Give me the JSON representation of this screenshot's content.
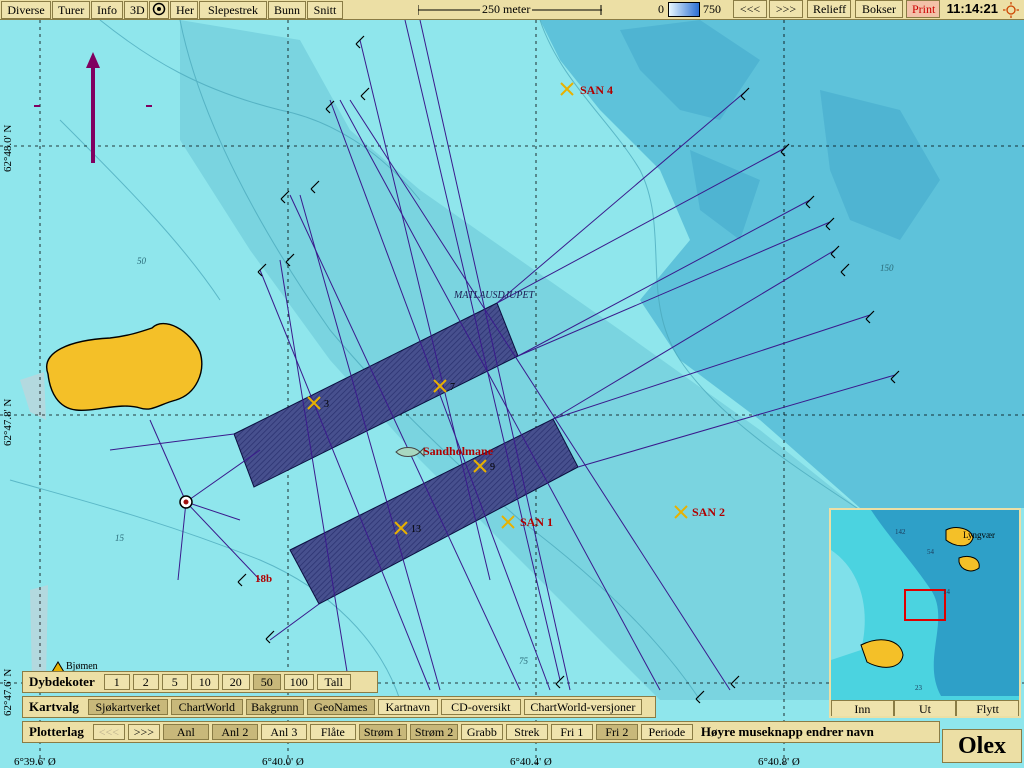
{
  "toolbar": {
    "diverse": "Diverse",
    "turer": "Turer",
    "info": "Info",
    "threed": "3D",
    "her": "Her",
    "slepestrek": "Slepestrek",
    "bunn": "Bunn",
    "snitt": "Snitt",
    "scale_label": "250 meter",
    "depth_min": "0",
    "depth_max": "750",
    "back": "<<<",
    "fwd": ">>>",
    "relieff": "Relieff",
    "bokser": "Bokser",
    "print": "Print",
    "time": "11:14:21"
  },
  "map": {
    "area_name": "MATLAUSDJUPET",
    "fish_label": "Sandholmane",
    "marks": {
      "san4": "SAN 4",
      "san1": "SAN 1",
      "san2": "SAN 2",
      "m3": "3",
      "m7": "7",
      "m9": "9",
      "m13": "13",
      "m18b": "18b"
    },
    "depth_labels": {
      "d50": "50",
      "d15": "15",
      "d75": "75",
      "d150": "150"
    },
    "place": "Bjømen"
  },
  "coords": {
    "lat1": "62°48.0' N",
    "lat2": "62°47.8' N",
    "lat3": "62°47.6' N",
    "lon0": "6°39.6' Ø",
    "lon1": "6°40.0' Ø",
    "lon2": "6°40.4' Ø",
    "lon3": "6°40.8' Ø"
  },
  "dybdekoter": {
    "label": "Dybdekoter",
    "opts": [
      "1",
      "2",
      "5",
      "10",
      "20",
      "50",
      "100",
      "Tall"
    ],
    "selected": "50"
  },
  "kartvalg": {
    "label": "Kartvalg",
    "opts": [
      "Sjøkartverket",
      "ChartWorld",
      "Bakgrunn",
      "GeoNames",
      "Kartnavn",
      "CD-oversikt",
      "ChartWorld-versjoner"
    ]
  },
  "plotterlag": {
    "label": "Plotterlag",
    "prev": "<<<",
    "next": ">>>",
    "opts": [
      "Anl",
      "Anl 2",
      "Anl 3",
      "Flåte",
      "Strøm 1",
      "Strøm 2",
      "Grabb",
      "Strek",
      "Fri 1",
      "Fri 2",
      "Periode"
    ],
    "hint": "Høyre museknapp endrer navn"
  },
  "inset": {
    "place": "Lyngvær",
    "inn": "Inn",
    "ut": "Ut",
    "flytt": "Flytt",
    "d1": "142",
    "d2": "54",
    "d3": "14",
    "d4": "23"
  },
  "logo": "Olex"
}
